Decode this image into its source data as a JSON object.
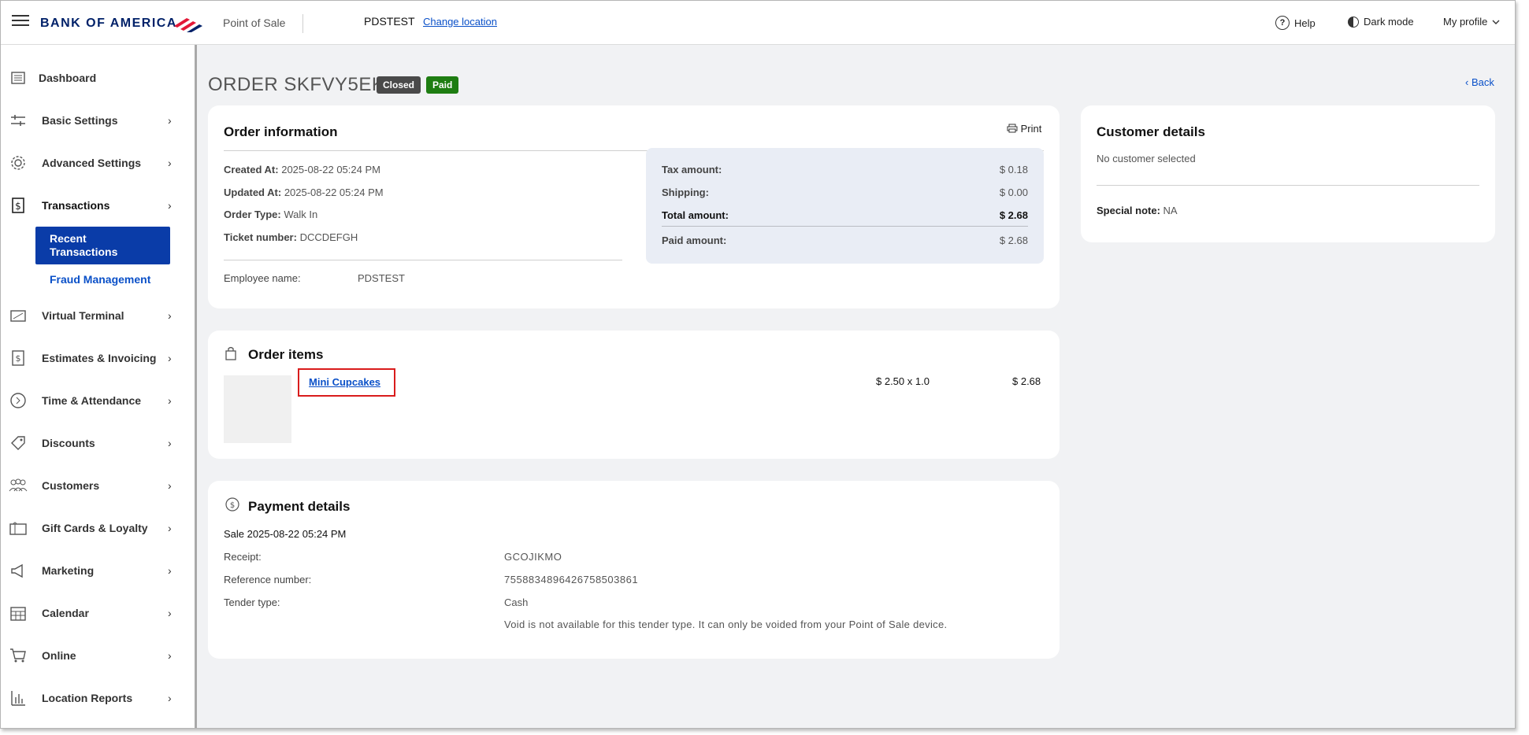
{
  "header": {
    "brand": "BANK OF AMERICA",
    "app_name": "Point of Sale",
    "store_name": "PDSTEST",
    "change_location": "Change location",
    "help": "Help",
    "dark_mode": "Dark mode",
    "profile": "My profile"
  },
  "sidebar": {
    "items": [
      {
        "label": "Dashboard",
        "icon": "dashboard-icon"
      },
      {
        "label": "Basic Settings",
        "icon": "sliders-icon"
      },
      {
        "label": "Advanced Settings",
        "icon": "gear-icon"
      },
      {
        "label": "Transactions",
        "icon": "dollar-doc-icon"
      },
      {
        "label": "Virtual Terminal",
        "icon": "terminal-icon"
      },
      {
        "label": "Estimates & Invoicing",
        "icon": "invoice-icon"
      },
      {
        "label": "Time & Attendance",
        "icon": "clock-icon"
      },
      {
        "label": "Discounts",
        "icon": "tag-icon"
      },
      {
        "label": "Customers",
        "icon": "people-icon"
      },
      {
        "label": "Gift Cards & Loyalty",
        "icon": "gift-card-icon"
      },
      {
        "label": "Marketing",
        "icon": "megaphone-icon"
      },
      {
        "label": "Calendar",
        "icon": "calendar-icon"
      },
      {
        "label": "Online",
        "icon": "cart-icon"
      },
      {
        "label": "Location Reports",
        "icon": "bar-chart-icon"
      }
    ],
    "sub_items": {
      "recent_transactions": "Recent Transactions",
      "fraud_management": "Fraud Management"
    }
  },
  "order": {
    "title": "ORDER SKFVY5EK",
    "status_closed": "Closed",
    "status_paid": "Paid",
    "back": "Back"
  },
  "order_info": {
    "heading": "Order information",
    "print": "Print",
    "created_label": "Created At:",
    "created_value": "2025-08-22 05:24 PM",
    "updated_label": "Updated At:",
    "updated_value": "2025-08-22 05:24 PM",
    "type_label": "Order Type:",
    "type_value": "Walk In",
    "ticket_label": "Ticket number:",
    "ticket_value": "DCCDEFGH",
    "employee_label": "Employee name:",
    "employee_value": "PDSTEST",
    "tax_label": "Tax amount:",
    "tax_value": "$ 0.18",
    "shipping_label": "Shipping:",
    "shipping_value": "$ 0.00",
    "total_label": "Total amount:",
    "total_value": "$ 2.68",
    "paid_label": "Paid amount:",
    "paid_value": "$ 2.68"
  },
  "order_items": {
    "heading": "Order items",
    "items": [
      {
        "name": "Mini Cupcakes",
        "price_qty": "$ 2.50 x 1.0",
        "total": "$ 2.68"
      }
    ]
  },
  "payment": {
    "heading": "Payment details",
    "sale_line": "Sale 2025-08-22 05:24 PM",
    "receipt_label": "Receipt:",
    "receipt_value": "GCOJIKMO",
    "ref_label": "Reference number:",
    "ref_value": "7558834896426758503861",
    "tender_label": "Tender type:",
    "tender_value": "Cash",
    "void_note": "Void is not available for this tender type. It can only be voided from your Point of Sale device."
  },
  "customer": {
    "heading": "Customer details",
    "none": "No customer selected",
    "note_label": "Special note:",
    "note_value": "NA"
  },
  "colors": {
    "brand_blue": "#012169",
    "brand_red": "#e31837",
    "link_blue": "#0a50c8",
    "active_nav": "#0a3ca8",
    "badge_closed": "#4a4a4a",
    "badge_paid": "#1e7d12",
    "highlight_red": "#d91c1c"
  }
}
